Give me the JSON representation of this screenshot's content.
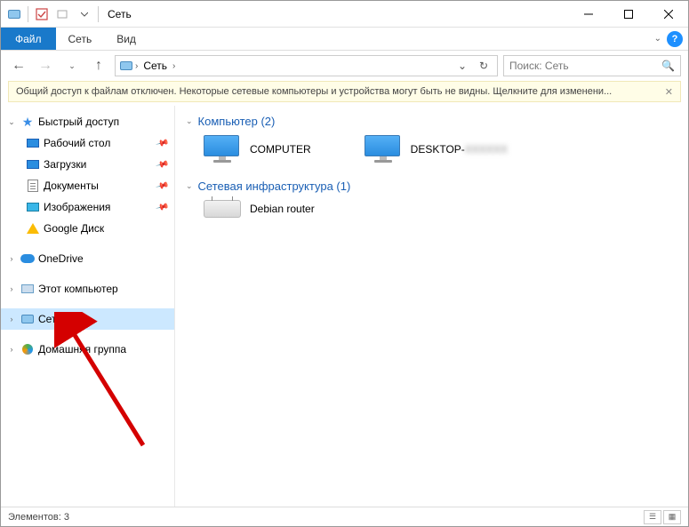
{
  "window": {
    "title": "Сеть"
  },
  "ribbon": {
    "file": "Файл",
    "tabs": [
      "Сеть",
      "Вид"
    ],
    "help": "?"
  },
  "nav": {
    "crumb": "Сеть",
    "refresh_glyph": "↻",
    "search_placeholder": "Поиск: Сеть"
  },
  "infobar": {
    "text": "Общий доступ к файлам отключен. Некоторые сетевые компьютеры и устройства могут быть не видны. Щелкните для изменени..."
  },
  "sidebar": {
    "quick_access": "Быстрый доступ",
    "items": [
      {
        "label": "Рабочий стол",
        "pinned": true,
        "icon": "desktop"
      },
      {
        "label": "Загрузки",
        "pinned": true,
        "icon": "downloads"
      },
      {
        "label": "Документы",
        "pinned": true,
        "icon": "doc"
      },
      {
        "label": "Изображения",
        "pinned": true,
        "icon": "pictures"
      },
      {
        "label": "Google Диск",
        "pinned": false,
        "icon": "gdrive"
      }
    ],
    "onedrive": "OneDrive",
    "this_pc": "Этот компьютер",
    "network": "Сеть",
    "homegroup": "Домашняя группа"
  },
  "content": {
    "group_computers": {
      "label": "Компьютер",
      "count": 2
    },
    "computers": [
      {
        "name": "COMPUTER"
      },
      {
        "name": "DESKTOP-",
        "blurred_suffix": "XXXXXX"
      }
    ],
    "group_infra": {
      "label": "Сетевая инфраструктура",
      "count": 1
    },
    "infra": [
      {
        "name": "Debian router"
      }
    ]
  },
  "statusbar": {
    "text": "Элементов: 3"
  }
}
